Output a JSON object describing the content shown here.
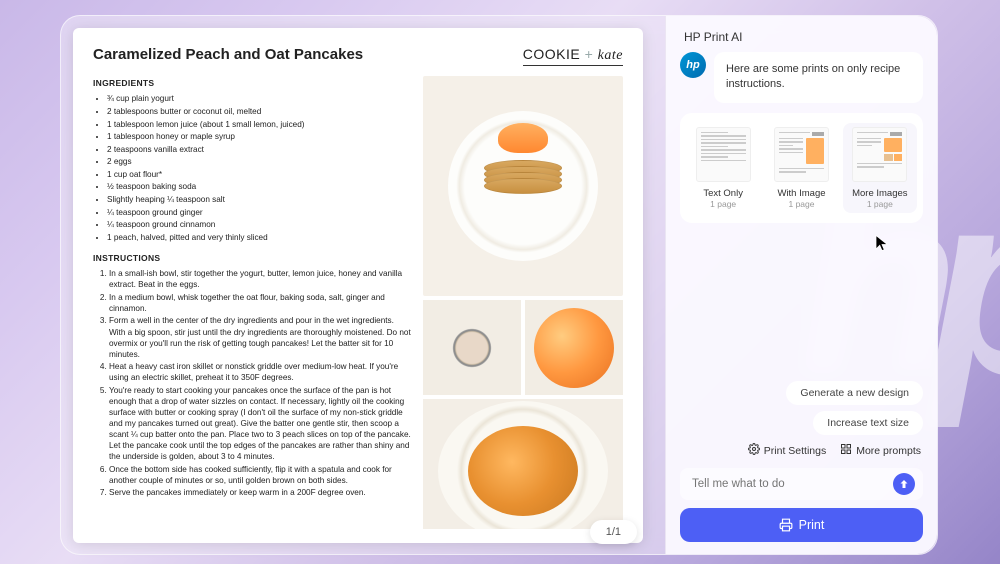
{
  "document": {
    "title": "Caramelized Peach and Oat Pancakes",
    "brand_left": "COOKIE",
    "brand_right": "kate",
    "ingredients_heading": "INGREDIENTS",
    "ingredients": [
      "¾ cup plain yogurt",
      "2 tablespoons butter or coconut oil, melted",
      "1 tablespoon lemon juice (about 1 small lemon, juiced)",
      "1 tablespoon honey or maple syrup",
      "2 teaspoons vanilla extract",
      "2 eggs",
      "1 cup oat flour*",
      "½ teaspoon baking soda",
      "Slightly heaping ¼ teaspoon salt",
      "¼ teaspoon ground ginger",
      "¼ teaspoon ground cinnamon",
      "1 peach, halved, pitted and very thinly sliced"
    ],
    "instructions_heading": "INSTRUCTIONS",
    "instructions": [
      "In a small-ish bowl, stir together the yogurt, butter, lemon juice, honey and vanilla extract. Beat in the eggs.",
      "In a medium bowl, whisk together the oat flour, baking soda, salt, ginger and cinnamon.",
      "Form a well in the center of the dry ingredients and pour in the wet ingredients. With a big spoon, stir just until the dry ingredients are thoroughly moistened. Do not overmix or you'll run the risk of getting tough pancakes! Let the batter sit for 10 minutes.",
      "Heat a heavy cast iron skillet or nonstick griddle over medium-low heat. If you're using an electric skillet, preheat it to 350F degrees.",
      "You're ready to start cooking your pancakes once the surface of the pan is hot enough that a drop of water sizzles on contact. If necessary, lightly oil the cooking surface with butter or cooking spray (I don't oil the surface of my non-stick griddle and my pancakes turned out great). Give the batter one gentle stir, then scoop a scant ¼ cup batter onto the pan. Place two to 3 peach slices on top of the pancake. Let the pancake cook until the top edges of the pancakes are rather than shiny and the underside is golden, about 3 to 4 minutes.",
      "Once the bottom side has cooked sufficiently, flip it with a spatula and cook for another couple of minutes or so, until golden brown on both sides.",
      "Serve the pancakes immediately or keep warm in a 200F degree oven."
    ],
    "page_indicator": "1/1"
  },
  "ai_panel": {
    "header": "HP Print AI",
    "message": "Here are some prints on only recipe instructions.",
    "options": [
      {
        "title": "Text Only",
        "sub": "1 page"
      },
      {
        "title": "With Image",
        "sub": "1 page"
      },
      {
        "title": "More Images",
        "sub": "1 page"
      }
    ],
    "chips": [
      "Generate a new design",
      "Increase text size"
    ],
    "tools": {
      "settings": "Print Settings",
      "prompts": "More prompts"
    },
    "input_placeholder": "Tell me what to do",
    "print_label": "Print"
  }
}
